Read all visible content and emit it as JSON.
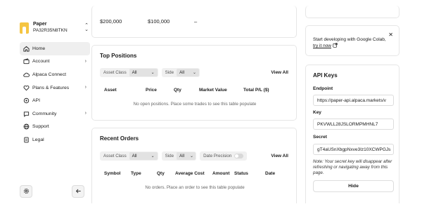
{
  "account": {
    "name": "Paper",
    "id": "PA32R35N8TKN"
  },
  "nav": {
    "home": "Home",
    "account": "Account",
    "connect": "Alpaca Connect",
    "plans": "Plans & Features",
    "api": "API",
    "community": "Community",
    "support": "Support",
    "legal": "Legal"
  },
  "summary": {
    "v1": "$200,000",
    "v2": "$100,000",
    "v3": "–"
  },
  "positions": {
    "title": "Top Positions",
    "asset_class_label": "Asset Class",
    "asset_class_value": "All",
    "side_label": "Side",
    "side_value": "All",
    "view_all": "View All",
    "columns": [
      "Asset",
      "Price",
      "Qty",
      "Market Value",
      "Total P/L ($)"
    ],
    "empty": "No open positions. Place some trades to see this table populate"
  },
  "orders": {
    "title": "Recent Orders",
    "asset_class_label": "Asset Class",
    "asset_class_value": "All",
    "side_label": "Side",
    "side_value": "All",
    "date_precision_label": "Date Precision",
    "view_all": "View All",
    "columns": [
      "Symbol",
      "Type",
      "Qty",
      "Average Cost",
      "Amount",
      "Status",
      "Date"
    ],
    "empty": "No orders. Place an order to see this table populate"
  },
  "colab": {
    "text": "Start developing with Google Colab,",
    "link": "try it now"
  },
  "api": {
    "title": "API Keys",
    "endpoint_label": "Endpoint",
    "endpoint_value": "https://paper-api.alpaca.markets/v",
    "key_label": "Key",
    "key_value": "PKVWLL28JSLORMPMHNL7",
    "secret_label": "Secret",
    "secret_value": "gT4aUSnXbgpNxve3Iz10XCWPGJs",
    "note": "Note: Your secret key will disappear after refreshing or navigating away from this page.",
    "hide_label": "Hide"
  }
}
